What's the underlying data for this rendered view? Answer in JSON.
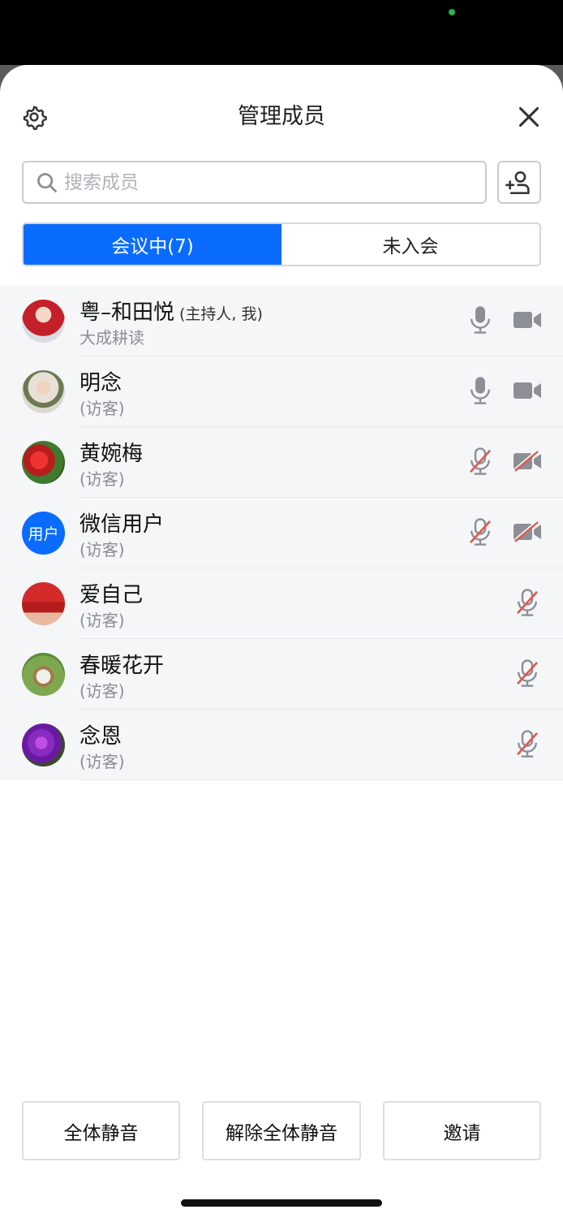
{
  "header": {
    "title": "管理成员",
    "settings_icon": "gear-icon",
    "close_icon": "close-icon"
  },
  "search": {
    "placeholder": "搜索成员",
    "value": ""
  },
  "tabs": [
    {
      "label": "会议中(7)",
      "active": true
    },
    {
      "label": "未入会",
      "active": false
    }
  ],
  "members": [
    {
      "name": "粤–和田悦",
      "role": "(主持人, 我)",
      "subtitle": "大成耕读",
      "mic": "on",
      "camera": "on"
    },
    {
      "name": "明念",
      "role": "",
      "subtitle": "(访客)",
      "mic": "on",
      "camera": "on"
    },
    {
      "name": "黄婉梅",
      "role": "",
      "subtitle": "(访客)",
      "mic": "off",
      "camera": "off"
    },
    {
      "name": "微信用户",
      "role": "",
      "subtitle": "(访客)",
      "mic": "off",
      "camera": "off",
      "avatar_text": "用户"
    },
    {
      "name": "爱自己",
      "role": "",
      "subtitle": "(访客)",
      "mic": "off",
      "camera": "none"
    },
    {
      "name": "春暖花开",
      "role": "",
      "subtitle": "(访客)",
      "mic": "off",
      "camera": "none"
    },
    {
      "name": "念恩",
      "role": "",
      "subtitle": "(访客)",
      "mic": "off",
      "camera": "none"
    }
  ],
  "footer": {
    "mute_all": "全体静音",
    "unmute_all": "解除全体静音",
    "invite": "邀请"
  },
  "colors": {
    "accent": "#0a6cff",
    "muted_slash": "#e05a4f",
    "icon_gray": "#8c9096"
  }
}
